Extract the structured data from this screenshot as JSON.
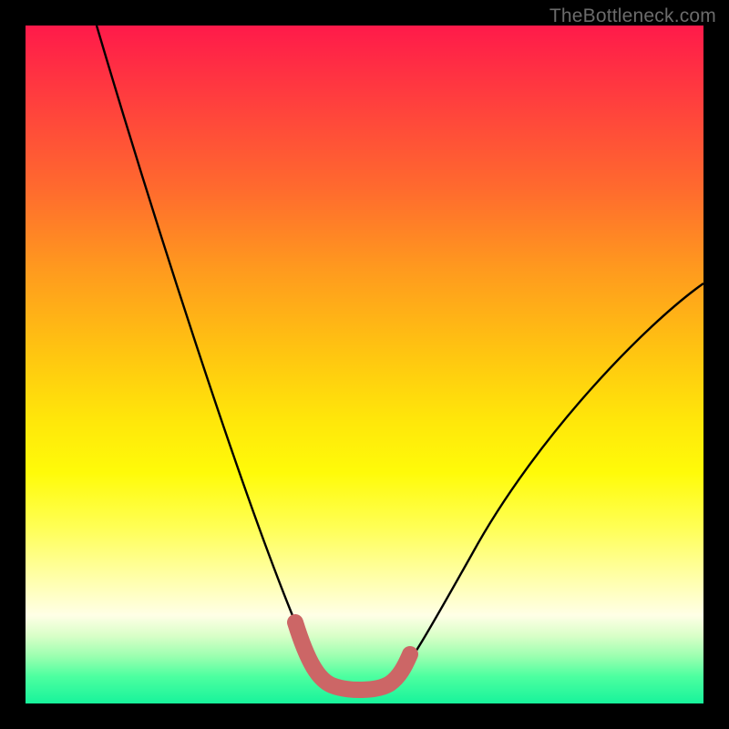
{
  "watermark": "TheBottleneck.com",
  "chart_data": {
    "type": "line",
    "title": "",
    "xlabel": "",
    "ylabel": "",
    "xlim": [
      0,
      100
    ],
    "ylim": [
      0,
      100
    ],
    "grid": false,
    "legend": false,
    "gradient_scale": {
      "description": "background vertical gradient, red (top, worst) to green (bottom, best)",
      "stops": [
        {
          "pct": 0,
          "color": "#ff1a4a"
        },
        {
          "pct": 50,
          "color": "#ffe60a"
        },
        {
          "pct": 90,
          "color": "#ffffe6"
        },
        {
          "pct": 100,
          "color": "#17f39b"
        }
      ]
    },
    "series": [
      {
        "name": "bottleneck-curve",
        "stroke": "#000000",
        "x": [
          10,
          15,
          20,
          25,
          30,
          35,
          38,
          41,
          44,
          47,
          50,
          55,
          60,
          65,
          70,
          75,
          80,
          85,
          90,
          95,
          100
        ],
        "values": [
          100,
          85,
          70,
          56,
          42,
          29,
          20,
          12,
          6,
          3,
          2,
          3,
          7,
          13,
          20,
          27,
          34,
          41,
          47,
          52,
          57
        ]
      },
      {
        "name": "optimal-marker",
        "stroke": "#cc6666",
        "x": [
          40,
          42,
          44,
          46,
          48,
          50,
          52,
          54
        ],
        "values": [
          11,
          7,
          4,
          3,
          3,
          3,
          4,
          7
        ]
      }
    ]
  }
}
